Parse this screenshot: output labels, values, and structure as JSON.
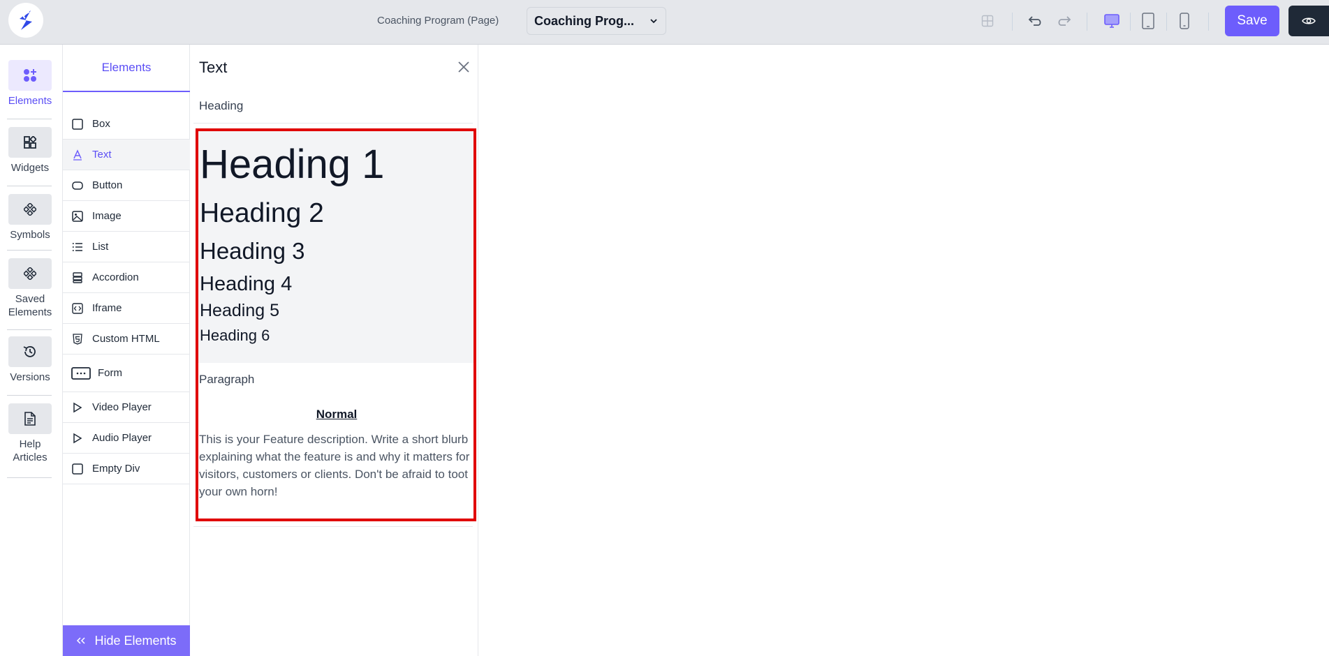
{
  "topbar": {
    "page_label": "Coaching Program (Page)",
    "page_select_value": "Coaching Prog...",
    "save_label": "Save",
    "accent_color": "#6d5dfc"
  },
  "rail": {
    "items": [
      {
        "label": "Elements",
        "icon": "elements-icon",
        "active": true
      },
      {
        "label": "Widgets",
        "icon": "widgets-icon"
      },
      {
        "label": "Symbols",
        "icon": "symbols-icon"
      },
      {
        "label": "Saved Elements",
        "icon": "saved-elements-icon"
      },
      {
        "label": "Versions",
        "icon": "history-icon"
      },
      {
        "label": "Help Articles",
        "icon": "document-icon"
      }
    ]
  },
  "elements_panel": {
    "title": "Elements",
    "items": [
      {
        "label": "Box",
        "icon": "box-icon"
      },
      {
        "label": "Text",
        "icon": "text-icon",
        "active": true
      },
      {
        "label": "Button",
        "icon": "button-icon"
      },
      {
        "label": "Image",
        "icon": "image-icon"
      },
      {
        "label": "List",
        "icon": "list-icon"
      },
      {
        "label": "Accordion",
        "icon": "accordion-icon"
      },
      {
        "label": "Iframe",
        "icon": "iframe-icon"
      },
      {
        "label": "Custom HTML",
        "icon": "html5-icon"
      },
      {
        "label": "Form",
        "icon": "form-icon"
      },
      {
        "label": "Video Player",
        "icon": "play-icon"
      },
      {
        "label": "Audio Player",
        "icon": "play-icon"
      },
      {
        "label": "Empty Div",
        "icon": "box-icon"
      }
    ],
    "hide_label": "Hide Elements"
  },
  "text_panel": {
    "title": "Text",
    "heading_label": "Heading",
    "headings": [
      "Heading 1",
      "Heading 2",
      "Heading 3",
      "Heading 4",
      "Heading 5",
      "Heading 6"
    ],
    "paragraph_label": "Paragraph",
    "paragraph_title": "Normal",
    "paragraph_body": "This is your Feature description. Write a short blurb explaining what the feature is and why it matters for visitors, customers or clients. Don't be afraid to toot your own horn!",
    "highlight_color": "#e00000"
  }
}
